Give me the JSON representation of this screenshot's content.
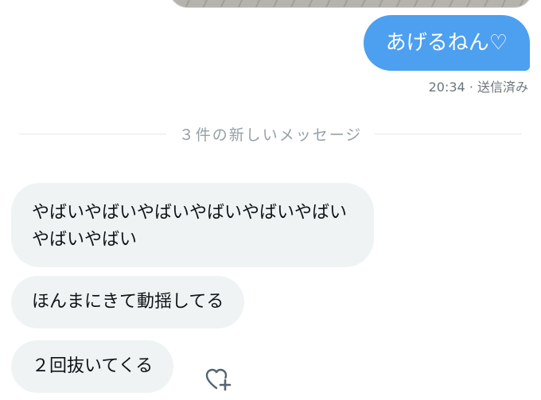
{
  "messages": {
    "sent": {
      "text": "あげるねん♡",
      "meta": "20:34 · 送信済み"
    },
    "divider": {
      "text": "３件の新しいメッセージ"
    },
    "received": [
      {
        "text": "やばいやばいやばいやばいやばいやばいやばいやばい"
      },
      {
        "text": "ほんまにきて動揺してる"
      },
      {
        "text": "２回抜いてくる"
      }
    ],
    "reaction_icon": "heart-plus-icon"
  },
  "colors": {
    "sent_bubble": "#4d9ff0",
    "received_bubble": "#eff3f4",
    "meta_text": "#6e767d",
    "divider_text": "#97a0a8"
  }
}
